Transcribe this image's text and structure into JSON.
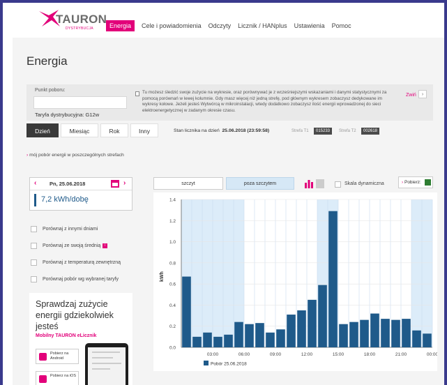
{
  "brand": {
    "name": "TAURON",
    "sub": "DYSTRYBUCJA",
    "accent": "#e2007a"
  },
  "nav": [
    {
      "label": "Energia",
      "active": true
    },
    {
      "label": "Cele i powiadomienia"
    },
    {
      "label": "Odczyty"
    },
    {
      "label": "Licznik / HANplus"
    },
    {
      "label": "Ustawienia"
    },
    {
      "label": "Pomoc"
    }
  ],
  "page": {
    "title": "Energia"
  },
  "info": {
    "punkt_label": "Punkt poboru:",
    "punkt_value": "",
    "tariff": "Taryfa dystrybucyjna: G12w",
    "text": "Tu możesz śledzić swoje zużycie na wykresie, oraz porównywać je z wcześniejszymi wskazaniami i danymi statystycznymi za pomocą porównań w lewej kolumnie. Gdy masz więcej niż jedną strefę, pod głównym wykresem zobaczysz dedykowane im wykresy kołowe. Jeżeli jesteś Wytwórcą w mikroinstalacji, wtedy dodatkowo zobaczysz ilość energii wprowadzonej do sieci elektroenergetycznej w zadanym okresie czasu.",
    "collapse": "Zwiń"
  },
  "tabs": [
    {
      "label": "Dzień",
      "active": true
    },
    {
      "label": "Miesiąc"
    },
    {
      "label": "Rok"
    },
    {
      "label": "Inny"
    }
  ],
  "meter": {
    "label": "Stan licznika na dzień",
    "date": "25.06.2018 (23:59:58)",
    "t1_label": "Strefa T1",
    "t1_value": "015233",
    "t2_label": "Strefa T2",
    "t2_value": "002618"
  },
  "zones_link": {
    "arrow": "›",
    "text": "mój pobór energii w poszczególnych strefach"
  },
  "day": {
    "prev": "‹",
    "date": "Pn, 25.06.2018",
    "next": "›",
    "value": "7,2 kWh/dobę"
  },
  "compare": [
    {
      "label": "Porównaj z innymi dniami"
    },
    {
      "label": "Porównaj ze swoją średnią",
      "badge": "i"
    },
    {
      "label": "Porównaj z temperaturą zewnętrzną"
    },
    {
      "label": "Porównaj pobór wg wybranej taryfy"
    }
  ],
  "promo": {
    "title": "Sprawdzaj zużycie energii gdziekolwiek jesteś",
    "subtitle": "Mobilny TAURON eLicznik",
    "android": "Pobierz na Android",
    "ios": "Pobierz na iOS"
  },
  "chart_controls": {
    "peak": "szczyt",
    "offpeak": "poza szczytem",
    "bar_icon": "bar-chart-icon",
    "area_icon": "area-chart-icon",
    "dynamic_scale": "Skala dynamiczna",
    "download": "Pobierz:",
    "download_arrow": "›",
    "xls_icon": "excel-icon"
  },
  "chart_data": {
    "type": "bar",
    "ylabel": "kWh",
    "ylim": [
      0,
      1.4
    ],
    "yticks": [
      "0.0",
      "0.2",
      "0.4",
      "0.6",
      "0.8",
      "1.0",
      "1.2",
      "1.4"
    ],
    "xticks": [
      "03:00",
      "06:00",
      "09:00",
      "12:00",
      "15:00",
      "18:00",
      "21:00",
      "00:00"
    ],
    "categories": [
      "01",
      "02",
      "03",
      "04",
      "05",
      "06",
      "07",
      "08",
      "09",
      "10",
      "11",
      "12",
      "13",
      "14",
      "15",
      "16",
      "17",
      "18",
      "19",
      "20",
      "21",
      "22",
      "23",
      "24"
    ],
    "series": [
      {
        "name": "Pobór 25.06.2018",
        "color": "#1f5a8a",
        "values": [
          0.67,
          0.1,
          0.14,
          0.1,
          0.12,
          0.24,
          0.22,
          0.23,
          0.14,
          0.17,
          0.31,
          0.35,
          0.45,
          0.59,
          1.29,
          0.22,
          0.24,
          0.26,
          0.32,
          0.27,
          0.26,
          0.27,
          0.16,
          0.13
        ]
      }
    ],
    "offpeak_hours": [
      1,
      2,
      3,
      4,
      5,
      6,
      14,
      15,
      23,
      24
    ],
    "offpeak_color": "#dcecf9",
    "legend": "bottom-left",
    "grid": true
  }
}
